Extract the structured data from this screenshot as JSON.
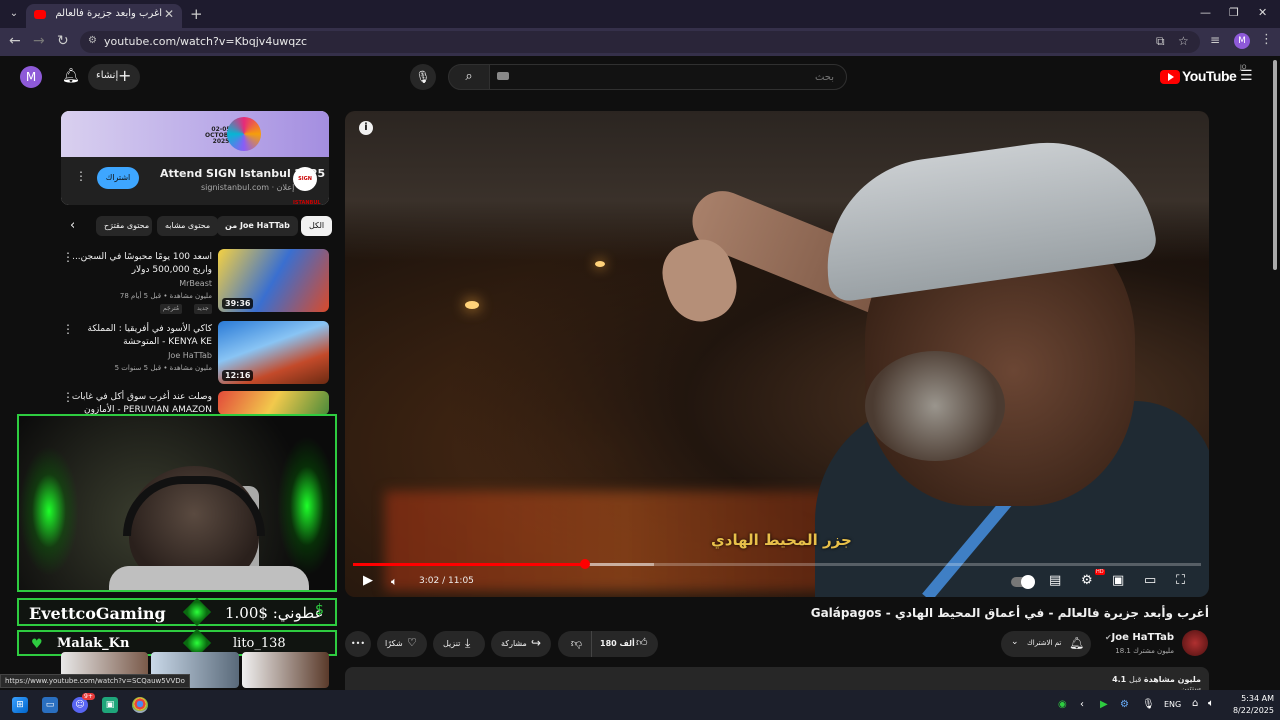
{
  "browser": {
    "tab_title": "أغرب وأبعد جزيرة فالعالم - في أ...",
    "tab_close": "✕",
    "new_tab": "+",
    "url": "youtube.com/watch?v=Kbqjv4uwqzc",
    "profile_initial": "M",
    "status_url": "https://www.youtube.com/watch?v=SCQauw5VVDo"
  },
  "header": {
    "avatar_initial": "M",
    "create_label": "إنشاء",
    "search_placeholder": "بحث",
    "logo_text": "YouTube",
    "region": "JO"
  },
  "ad": {
    "dates": "02-05\nOCTOBER\n2025",
    "title": "Attend SIGN Istanbul 2025",
    "domain": "signistanbul.com · إعلان",
    "badge": "SIGN ISTANBUL",
    "subscribe_label": "اشتراك"
  },
  "chips": {
    "all": "الكل",
    "from_channel": "من Joe HaTTab",
    "similar": "محتوى مشابه",
    "suggested": "محتوى مقترَح"
  },
  "related": [
    {
      "title": "اسعد 100 يومًا محبوسًا في السجن... واربح 500,000 دولار",
      "channel": "MrBeast",
      "meta": "78 مليون مشاهدة • قبل 5 أيام",
      "duration": "39:36",
      "badge_new": "جديد",
      "badge_sub": "مُترجَم"
    },
    {
      "title": "كاكي الأسود في أفريقيا : المملكة المتوحشة - KENYA KE",
      "channel": "Joe HaTTab",
      "meta": "5 مليون مشاهدة • قبل 5 سنوات",
      "duration": "12:16"
    },
    {
      "title": "وصلت عند أغرب سوق أكل في غابات الأمازون - PERUVIAN AMAZON",
      "channel": "",
      "meta": "",
      "duration": ""
    }
  ],
  "overlay": {
    "streamer": "EvettcoGaming",
    "donation_amount": "1.00$ :عطوني",
    "donor": "Malak_Kn",
    "donor_second": "lito_138",
    "dollar": "$",
    "heart": "♥"
  },
  "player": {
    "subtitle": "جزر المحيط  الهادي",
    "time": "3:02 / 11:05",
    "played_fraction": 0.274,
    "buffered_fraction": 0.355
  },
  "video": {
    "title": "أغرب وأبعد جزيرة فالعالم - في أعماق المحيط الهادي - Galápagos",
    "channel_name": "Joe HaTTab",
    "channel_subs": "18.1 مليون مشترك",
    "subscribed_label": "تم الاشتراك",
    "likes": "180 ألف",
    "share_label": "مشاركة",
    "download_label": "تنزيل",
    "thanks_label": "شكرًا",
    "more_label": "•••",
    "desc_views": "4.1 مليون مشاهدة",
    "desc_time": "قبل سنتين"
  },
  "taskbar": {
    "lang": "ENG",
    "time": "5:34 AM",
    "date": "8/22/2025",
    "discord_badge": "9+"
  },
  "colors": {
    "yt_red": "#ff0000",
    "overlay_green": "#2ecc40",
    "subtitle_gold": "#e8c04a"
  }
}
